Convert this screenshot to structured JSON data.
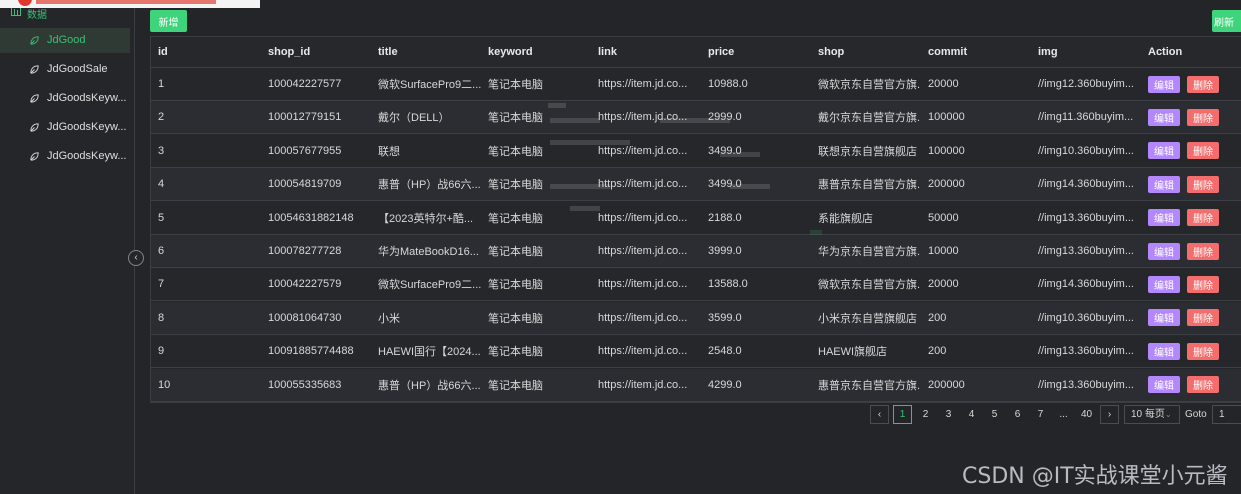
{
  "sidebar": {
    "group_label": "数据",
    "group_icon": "bar-chart-icon",
    "items": [
      {
        "label": "JdGood",
        "active": true
      },
      {
        "label": "JdGoodSale",
        "active": false
      },
      {
        "label": "JdGoodsKeyw...",
        "active": false
      },
      {
        "label": "JdGoodsKeyw...",
        "active": false
      },
      {
        "label": "JdGoodsKeyw...",
        "active": false
      }
    ],
    "item_icon": "leaf-icon",
    "collapse_icon": "chevron-left-icon"
  },
  "toolbar": {
    "add_label": "新增",
    "refresh_label": "刷新"
  },
  "table": {
    "headers": [
      "id",
      "shop_id",
      "title",
      "keyword",
      "link",
      "price",
      "shop",
      "commit",
      "img",
      "Action"
    ],
    "edit_label": "编辑",
    "delete_label": "删除",
    "rows": [
      [
        "1",
        "100042227577",
        "微软SurfacePro9二...",
        "笔记本电脑",
        "https://item.jd.co...",
        "10988.0",
        "微软京东自营官方旗...",
        "20000",
        "//img12.360buyim..."
      ],
      [
        "2",
        "100012779151",
        "戴尔（DELL）",
        "笔记本电脑",
        "https://item.jd.co...",
        "2999.0",
        "戴尔京东自营官方旗...",
        "100000",
        "//img11.360buyim..."
      ],
      [
        "3",
        "100057677955",
        "联想",
        "笔记本电脑",
        "https://item.jd.co...",
        "3499.0",
        "联想京东自营旗舰店",
        "100000",
        "//img10.360buyim..."
      ],
      [
        "4",
        "100054819709",
        "惠普（HP）战66六...",
        "笔记本电脑",
        "https://item.jd.co...",
        "3499.0",
        "惠普京东自营官方旗...",
        "200000",
        "//img14.360buyim..."
      ],
      [
        "5",
        "10054631882148",
        "【2023英特尔+酷...",
        "笔记本电脑",
        "https://item.jd.co...",
        "2188.0",
        "系能旗舰店",
        "50000",
        "//img13.360buyim..."
      ],
      [
        "6",
        "100078277728",
        "华为MateBookD16...",
        "笔记本电脑",
        "https://item.jd.co...",
        "3999.0",
        "华为京东自营官方旗...",
        "10000",
        "//img13.360buyim..."
      ],
      [
        "7",
        "100042227579",
        "微软SurfacePro9二...",
        "笔记本电脑",
        "https://item.jd.co...",
        "13588.0",
        "微软京东自营官方旗...",
        "20000",
        "//img14.360buyim..."
      ],
      [
        "8",
        "100081064730",
        "小米",
        "笔记本电脑",
        "https://item.jd.co...",
        "3599.0",
        "小米京东自营旗舰店",
        "200",
        "//img10.360buyim..."
      ],
      [
        "9",
        "10091885774488",
        "HAEWI国行【2024...",
        "笔记本电脑",
        "https://item.jd.co...",
        "2548.0",
        "HAEWI旗舰店",
        "200",
        "//img13.360buyim..."
      ],
      [
        "10",
        "100055335683",
        "惠普（HP）战66六...",
        "笔记本电脑",
        "https://item.jd.co...",
        "4299.0",
        "惠普京东自营官方旗...",
        "200000",
        "//img13.360buyim..."
      ]
    ]
  },
  "pagination": {
    "prev_icon": "chevron-left-icon",
    "next_icon": "chevron-right-icon",
    "pages": [
      "1",
      "2",
      "3",
      "4",
      "5",
      "6",
      "7",
      "...",
      "40"
    ],
    "current_page": "1",
    "page_size": "10 每页",
    "goto_label": "Goto",
    "goto_value": "1"
  },
  "watermark": "CSDN @IT实战课堂小元酱",
  "colors": {
    "accent": "#38c172",
    "add_button": "#3fd47c",
    "edit_button": "#b388ff",
    "delete_button": "#f56c6c",
    "background": "#232529"
  }
}
